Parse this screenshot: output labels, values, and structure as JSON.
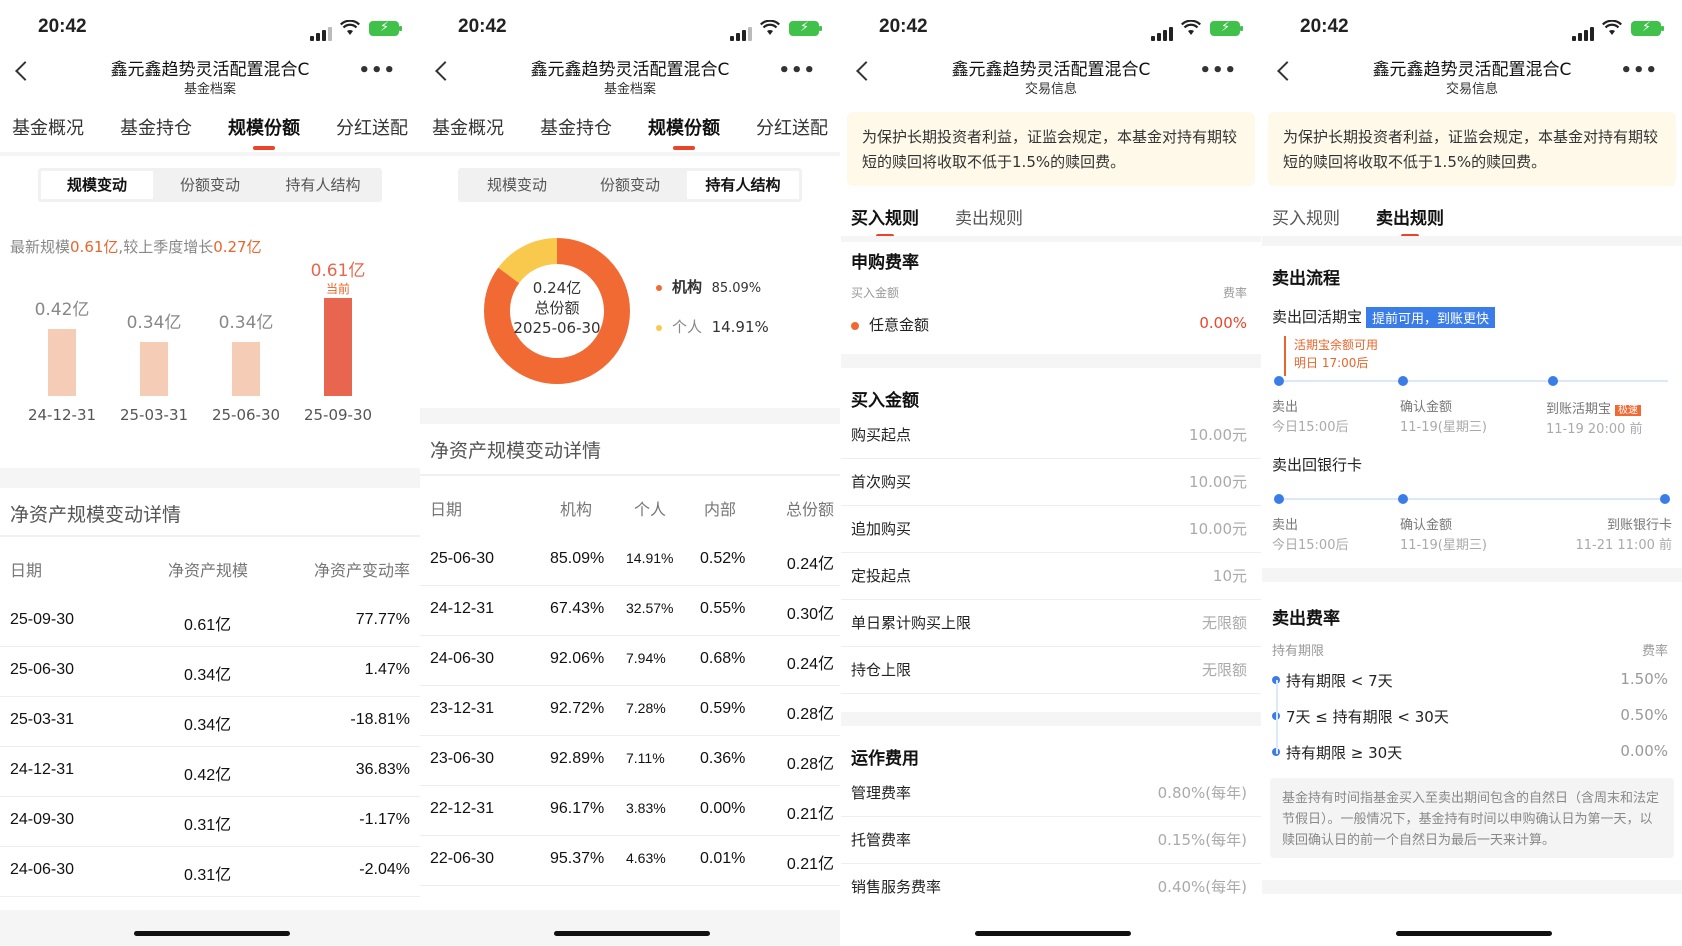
{
  "status": {
    "time": "20:42"
  },
  "fund_title": "鑫元鑫趋势灵活配置混合C",
  "nav_subtitles": [
    "基金档案",
    "基金档案",
    "交易信息",
    "交易信息"
  ],
  "more_glyph": "•••",
  "main_tabs": [
    "基金概况",
    "基金持仓",
    "规模份额",
    "分红送配"
  ],
  "seg_tabs": [
    "规模变动",
    "份额变动",
    "持有人结构"
  ],
  "scale_summary": {
    "prefix": "最新规模",
    "value": "0.61亿",
    "mid": ",较上季度增长",
    "growth": "0.27亿"
  },
  "chart_data": {
    "type": "bar",
    "categories": [
      "24-12-31",
      "25-03-31",
      "25-06-30",
      "25-09-30"
    ],
    "values": [
      0.42,
      0.34,
      0.34,
      0.61
    ],
    "labels": [
      "0.42亿",
      "0.34亿",
      "0.34亿",
      "0.61亿"
    ],
    "current_label": "当前",
    "colors": {
      "normal": "#f5cdb6",
      "current": "#e8664f"
    }
  },
  "net_asset_detail": {
    "title": "净资产规模变动详情",
    "headers": [
      "日期",
      "净资产规模",
      "净资产变动率"
    ],
    "rows": [
      [
        "25-09-30",
        "0.61亿",
        "77.77%"
      ],
      [
        "25-06-30",
        "0.34亿",
        "1.47%"
      ],
      [
        "25-03-31",
        "0.34亿",
        "-18.81%"
      ],
      [
        "24-12-31",
        "0.42亿",
        "36.83%"
      ],
      [
        "24-09-30",
        "0.31亿",
        "-1.17%"
      ],
      [
        "24-06-30",
        "0.31亿",
        "-2.04%"
      ]
    ]
  },
  "holder_structure": {
    "donut_center": [
      "0.24亿",
      "总份额",
      "2025-06-30"
    ],
    "legend": [
      {
        "name": "机构",
        "pct": "85.09%",
        "value": 85.09,
        "color": "#f26a33"
      },
      {
        "name": "个人",
        "pct": "14.91%",
        "value": 14.91,
        "color": "#f8c94c"
      }
    ]
  },
  "holder_detail": {
    "title": "净资产规模变动详情",
    "headers": [
      "日期",
      "机构",
      "个人",
      "内部",
      "总份额"
    ],
    "rows": [
      [
        "25-06-30",
        "85.09%",
        "14.91%",
        "0.52%",
        "0.24亿"
      ],
      [
        "24-12-31",
        "67.43%",
        "32.57%",
        "0.55%",
        "0.30亿"
      ],
      [
        "24-06-30",
        "92.06%",
        "7.94%",
        "0.68%",
        "0.24亿"
      ],
      [
        "23-12-31",
        "92.72%",
        "7.28%",
        "0.59%",
        "0.28亿"
      ],
      [
        "23-06-30",
        "92.89%",
        "7.11%",
        "0.36%",
        "0.28亿"
      ],
      [
        "22-12-31",
        "96.17%",
        "3.83%",
        "0.00%",
        "0.21亿"
      ],
      [
        "22-06-30",
        "95.37%",
        "4.63%",
        "0.01%",
        "0.21亿"
      ]
    ]
  },
  "notice": "为保护长期投资者利益，证监会规定，本基金对持有期较短的赎回将收取不低于1.5%的赎回费。",
  "rule_tabs": [
    "买入规则",
    "卖出规则"
  ],
  "buy": {
    "fee_title": "申购费率",
    "fee_headers": [
      "买入金额",
      "费率"
    ],
    "fee_row": {
      "k": "任意金额",
      "v": "0.00%"
    },
    "amount_title": "买入金额",
    "amount_rows": [
      {
        "k": "购买起点",
        "v": "10.00元"
      },
      {
        "k": "首次购买",
        "v": "10.00元"
      },
      {
        "k": "追加购买",
        "v": "10.00元"
      },
      {
        "k": "定投起点",
        "v": "10元"
      },
      {
        "k": "单日累计购买上限",
        "v": "无限额"
      },
      {
        "k": "持仓上限",
        "v": "无限额"
      }
    ],
    "ops_title": "运作费用",
    "ops_rows": [
      {
        "k": "管理费率",
        "v": "0.80%(每年)"
      },
      {
        "k": "托管费率",
        "v": "0.15%(每年)"
      },
      {
        "k": "销售服务费率",
        "v": "0.40%(每年)"
      }
    ]
  },
  "sell": {
    "flow_title": "卖出流程",
    "to_wallet": "卖出回活期宝",
    "to_wallet_badge": "提前可用，到账更快",
    "tip": [
      "活期宝余额可用",
      "明日 17:00后"
    ],
    "wallet_steps": [
      {
        "label": "卖出",
        "sub": "今日15:00后"
      },
      {
        "label": "确认金额",
        "sub": "11-19(星期三)"
      },
      {
        "label": "到账活期宝",
        "sub": "11-19 20:00 前",
        "badge": "极速"
      }
    ],
    "to_bank": "卖出回银行卡",
    "bank_steps": [
      {
        "label": "卖出",
        "sub": "今日15:00后"
      },
      {
        "label": "确认金额",
        "sub": "11-19(星期三)"
      },
      {
        "label": "到账银行卡",
        "sub": "11-21 11:00 前"
      }
    ],
    "fee_title": "卖出费率",
    "fee_headers": [
      "持有期限",
      "费率"
    ],
    "fee_rows": [
      {
        "k": "持有期限 < 7天",
        "v": "1.50%"
      },
      {
        "k": "7天 ≤ 持有期限 < 30天",
        "v": "0.50%"
      },
      {
        "k": "持有期限 ≥ 30天",
        "v": "0.00%"
      }
    ],
    "note": "基金持有时间指基金买入至卖出期间包含的自然日（含周末和法定节假日）。一般情况下，基金持有时间以申购确认日为第一天，以赎回确认日的前一个自然日为最后一天来计算。"
  }
}
